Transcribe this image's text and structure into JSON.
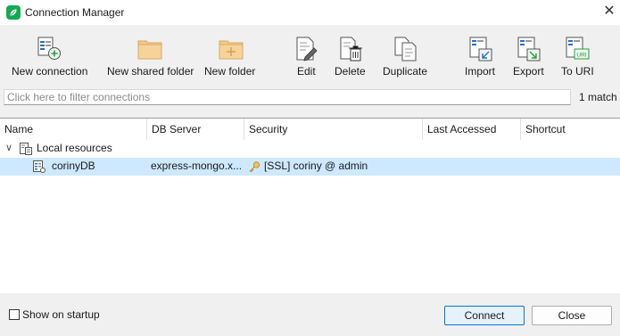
{
  "window": {
    "title": "Connection Manager",
    "brand_color": "#13aa52",
    "logo_icon": "leaf-icon",
    "close_glyph": "✕"
  },
  "toolbar": {
    "new_connection": "New connection",
    "new_shared_folder": "New shared folder",
    "new_folder": "New folder",
    "edit": "Edit",
    "delete": "Delete",
    "duplicate": "Duplicate",
    "import": "Import",
    "export": "Export",
    "to_uri": "To URI",
    "uri_badge": "URI"
  },
  "filter": {
    "placeholder": "Click here to filter connections",
    "value": "",
    "match_count": "1 match"
  },
  "columns": [
    "Name",
    "DB Server",
    "Security",
    "Last Accessed",
    "Shortcut"
  ],
  "tree": {
    "group": {
      "expander": "∨",
      "label": "Local resources",
      "icon": "local-resources-icon"
    },
    "connections": [
      {
        "name": "corinyDB",
        "db_server": "express-mongo.x...",
        "security": "[SSL] coriny @ admin",
        "last_accessed": "",
        "shortcut": "",
        "icon": "database-connection-icon",
        "security_icon": "key-icon",
        "selected": true
      }
    ]
  },
  "footer": {
    "show_on_startup": "Show on startup",
    "show_on_startup_checked": false,
    "connect": "Connect",
    "close": "Close"
  },
  "colors": {
    "selection": "#cde8ff",
    "folder": "#f4c98a",
    "default_button_border": "#0078d7"
  }
}
